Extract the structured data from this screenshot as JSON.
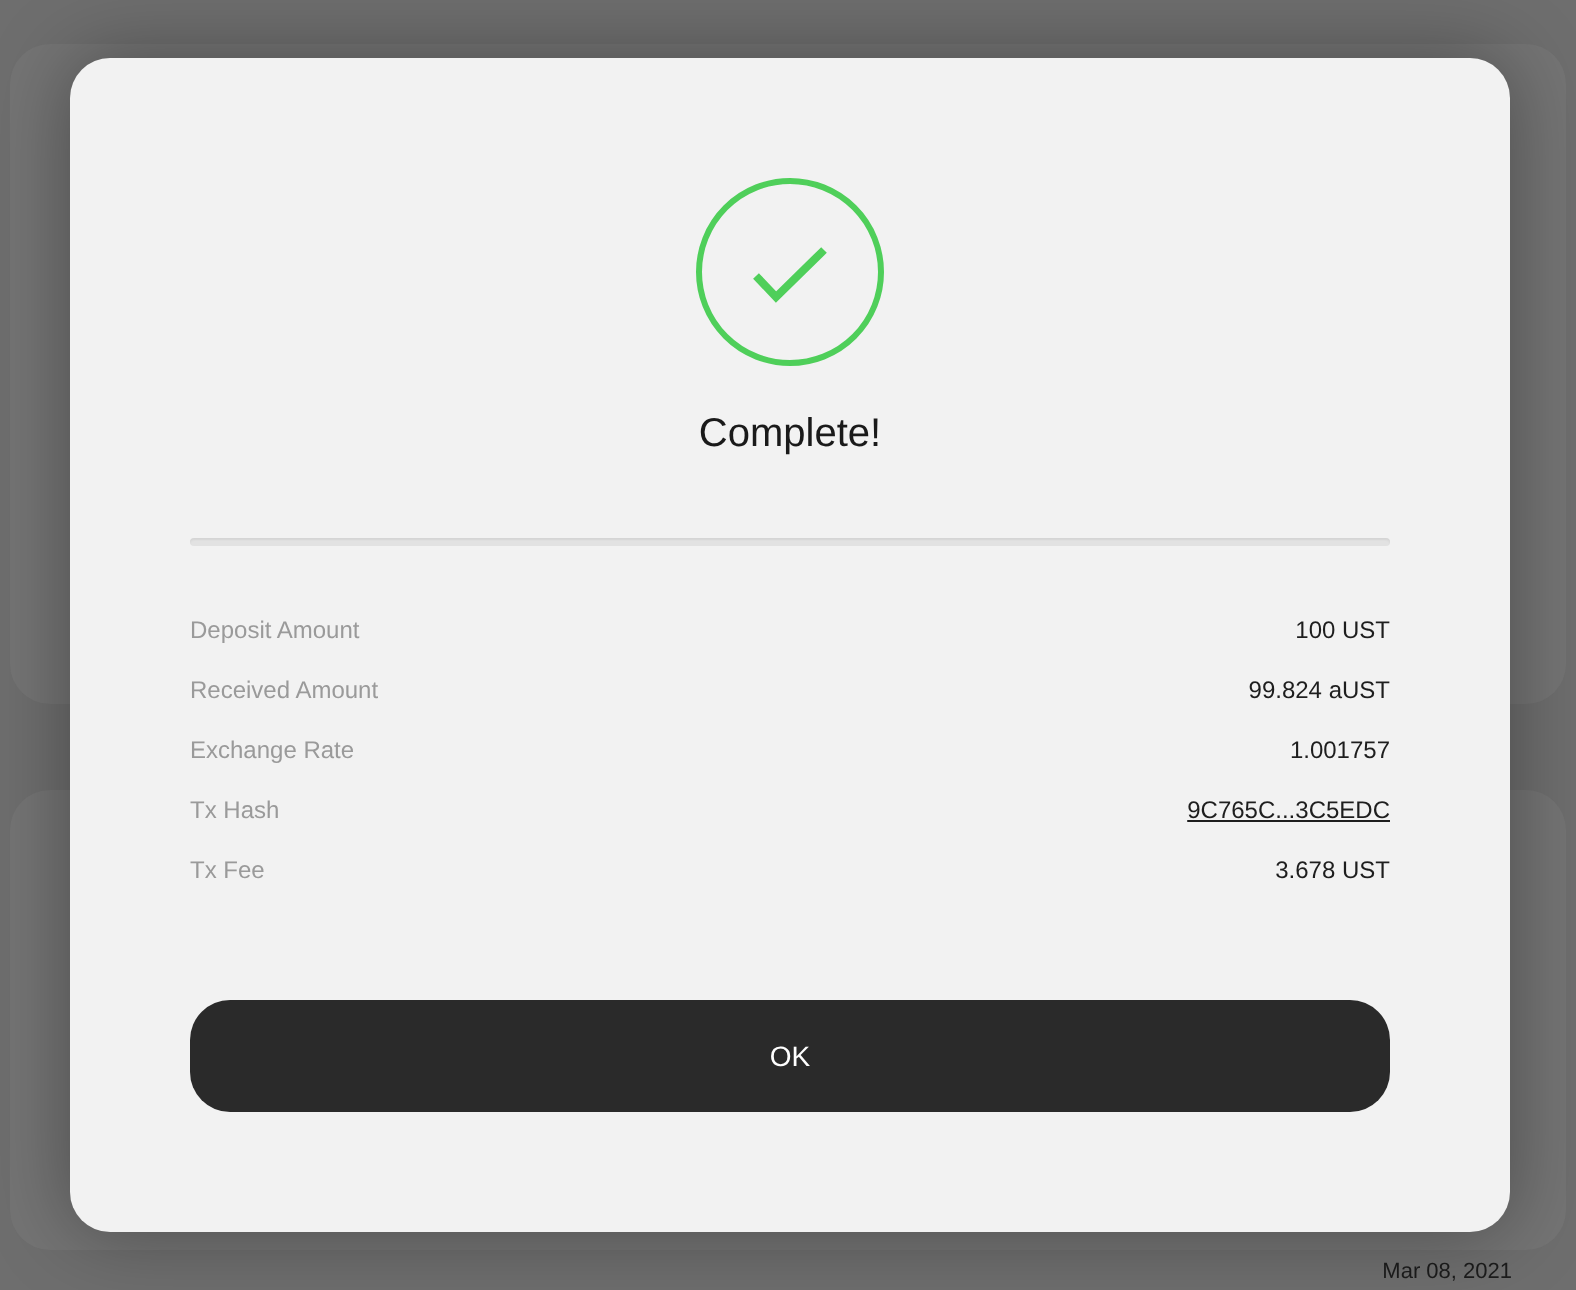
{
  "background": {
    "date": "Mar 08, 2021"
  },
  "modal": {
    "status": {
      "kind": "success"
    },
    "title": "Complete!",
    "details": [
      {
        "kind": "text",
        "label": "Deposit Amount",
        "value": "100 UST"
      },
      {
        "kind": "text",
        "label": "Received Amount",
        "value": "99.824 aUST"
      },
      {
        "kind": "text",
        "label": "Exchange Rate",
        "value": "1.001757"
      },
      {
        "kind": "link",
        "label": "Tx Hash",
        "value": "9C765C...3C5EDC"
      },
      {
        "kind": "text",
        "label": "Tx Fee",
        "value": "3.678 UST"
      }
    ],
    "button": "OK"
  }
}
